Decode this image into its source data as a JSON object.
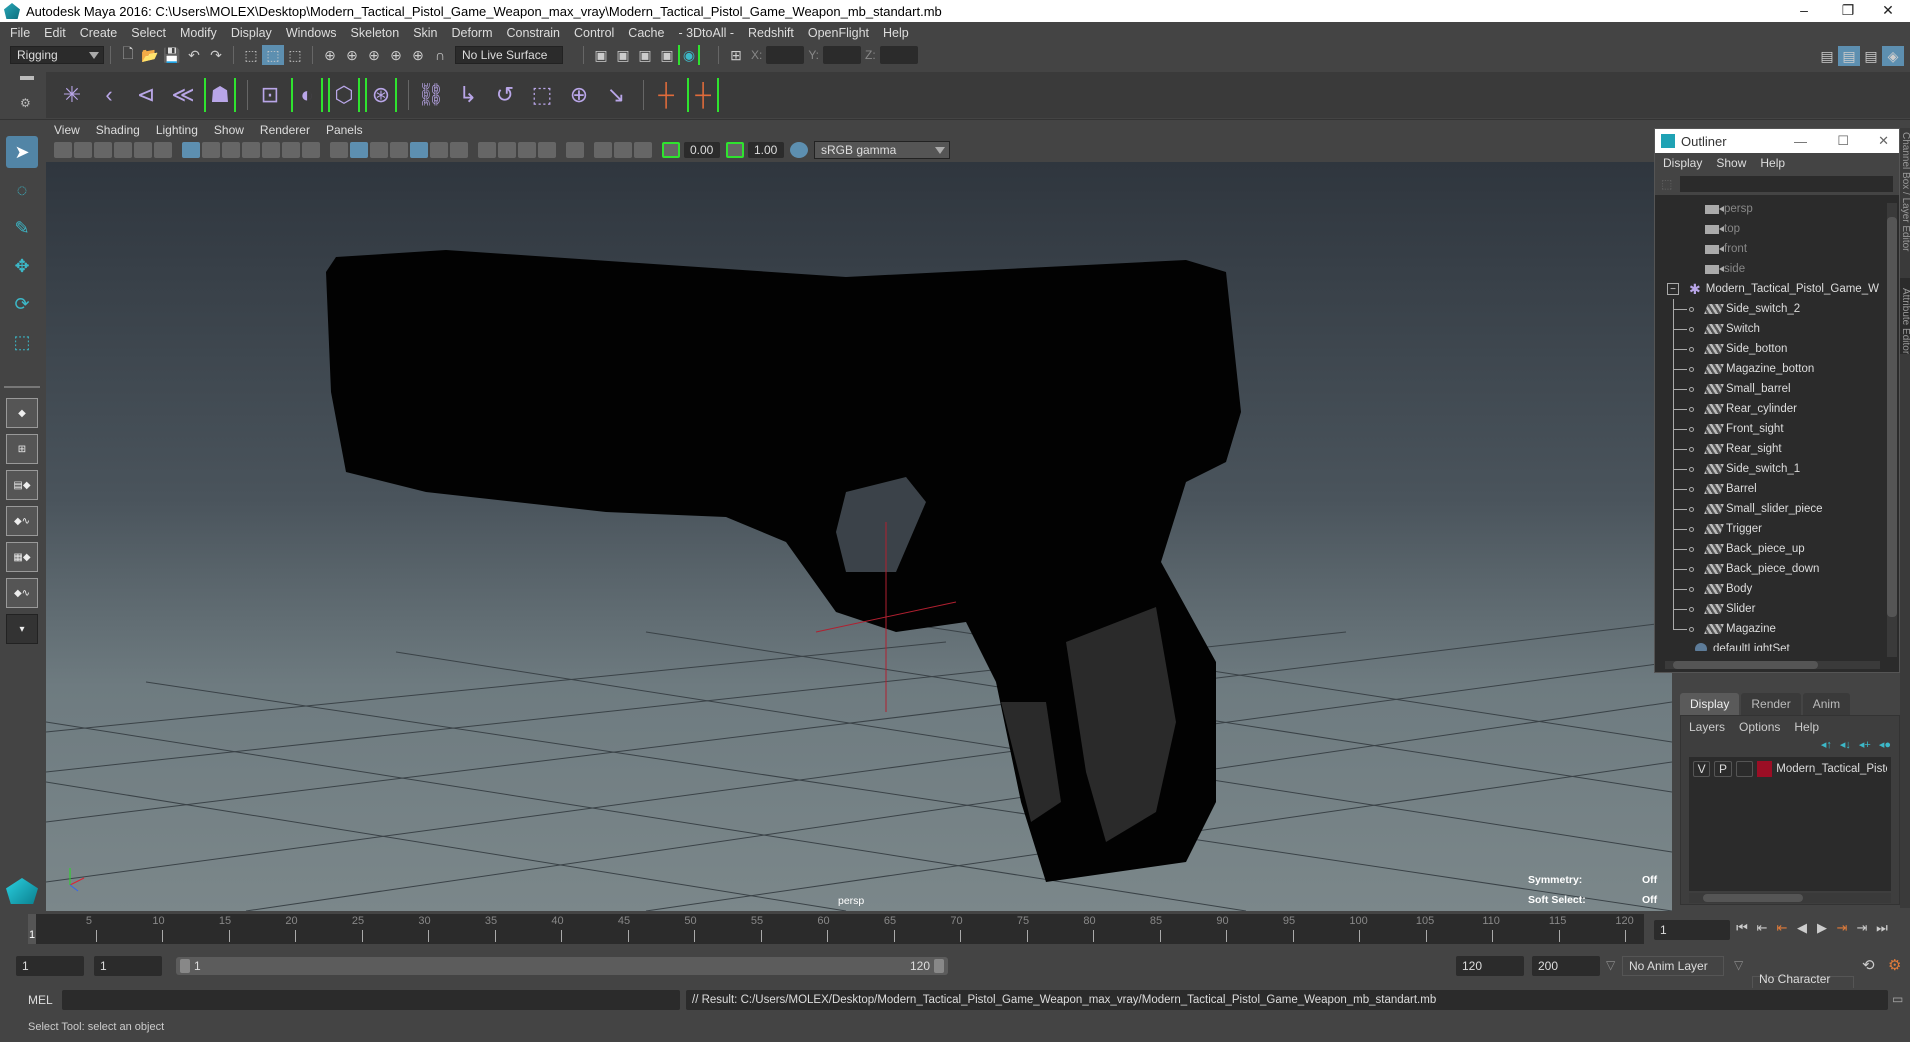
{
  "window": {
    "title": "Autodesk Maya 2016: C:\\Users\\MOLEX\\Desktop\\Modern_Tactical_Pistol_Game_Weapon_max_vray\\Modern_Tactical_Pistol_Game_Weapon_mb_standart.mb",
    "controls": {
      "minimize": "–",
      "restore": "❐",
      "close": "✕"
    }
  },
  "menubar": [
    "File",
    "Edit",
    "Create",
    "Select",
    "Modify",
    "Display",
    "Windows",
    "Skeleton",
    "Skin",
    "Deform",
    "Constrain",
    "Control",
    "Cache",
    "- 3DtoAll -",
    "Redshift",
    "OpenFlight",
    "Help"
  ],
  "statusline": {
    "menuset": "Rigging",
    "live_surface": "No Live Surface",
    "coord_labels": [
      "X:",
      "Y:",
      "Z:"
    ],
    "coord_values": [
      "",
      "",
      ""
    ]
  },
  "shelf": {
    "icons": [
      "joint-tool-icon",
      "insert-joint-icon",
      "ik-handle-icon",
      "ik-spline-icon",
      "quick-rig-icon",
      "paint-weights-icon",
      "bind-skin-icon",
      "wrap-deformer-icon",
      "blend-shape-icon",
      "parent-constraint-icon",
      "point-constraint-icon",
      "orient-constraint-icon",
      "scale-constraint-icon",
      "aim-constraint-icon",
      "pole-vector-icon",
      "locator-icon",
      "parent-icon"
    ]
  },
  "toolbox": {
    "tools": [
      "select-tool-icon",
      "lasso-tool-icon",
      "paint-select-icon",
      "move-tool-icon",
      "rotate-tool-icon",
      "scale-tool-icon"
    ],
    "layouts": [
      "single-pane-layout",
      "four-pane-layout",
      "outliner-persp-layout",
      "graph-persp-layout",
      "hypershade-layout",
      "custom-layout"
    ],
    "more": "▾"
  },
  "viewport": {
    "menu": [
      "View",
      "Shading",
      "Lighting",
      "Show",
      "Renderer",
      "Panels"
    ],
    "exposure": "0.00",
    "gamma": "1.00",
    "color_space": "sRGB gamma",
    "camera_label": "persp",
    "hud": [
      {
        "label": "Symmetry:",
        "value": "Off"
      },
      {
        "label": "Soft Select:",
        "value": "Off"
      }
    ]
  },
  "outliner": {
    "title": "Outliner",
    "menu": [
      "Display",
      "Show",
      "Help"
    ],
    "search_value": "",
    "cameras": [
      "persp",
      "top",
      "front",
      "side"
    ],
    "group": "Modern_Tactical_Pistol_Game_W",
    "children": [
      "Side_switch_2",
      "Switch",
      "Side_botton",
      "Magazine_botton",
      "Small_barrel",
      "Rear_cylinder",
      "Front_sight",
      "Rear_sight",
      "Side_switch_1",
      "Barrel",
      "Small_slider_piece",
      "Trigger",
      "Back_piece_up",
      "Back_piece_down",
      "Body",
      "Slider",
      "Magazine"
    ],
    "trailing": "defaultLightSet"
  },
  "side_tabs": [
    "Channel Box / Layer Editor",
    "Attribute Editor"
  ],
  "layer_editor": {
    "tabs": [
      "Display",
      "Render",
      "Anim"
    ],
    "active_tab": "Display",
    "menu": [
      "Layers",
      "Options",
      "Help"
    ],
    "layers": [
      {
        "v": "V",
        "p": "P",
        "color": "#9b0e25",
        "name": "Modern_Tactical_Pisto"
      }
    ]
  },
  "timeline": {
    "ticks": [
      "5",
      "10",
      "15",
      "20",
      "25",
      "30",
      "35",
      "40",
      "45",
      "50",
      "55",
      "60",
      "65",
      "70",
      "75",
      "80",
      "85",
      "90",
      "95",
      "100",
      "105",
      "110",
      "115",
      "120"
    ],
    "current_marker": "1",
    "current_frame": "1",
    "start_min": "1",
    "start": "1",
    "range_start": "1",
    "range_end": "120",
    "end": "120",
    "end_max": "200",
    "anim_layer": "No Anim Layer",
    "character_set": "No Character Set"
  },
  "playback": [
    "⏮",
    "⇤",
    "⇤",
    "◀",
    "▶",
    "⇥",
    "⇥",
    "⏭"
  ],
  "command_line": {
    "lang": "MEL",
    "input": "",
    "result": "// Result: C:/Users/MOLEX/Desktop/Modern_Tactical_Pistol_Game_Weapon_max_vray/Modern_Tactical_Pistol_Game_Weapon_mb_standart.mb"
  },
  "help_line": "Select Tool: select an object"
}
